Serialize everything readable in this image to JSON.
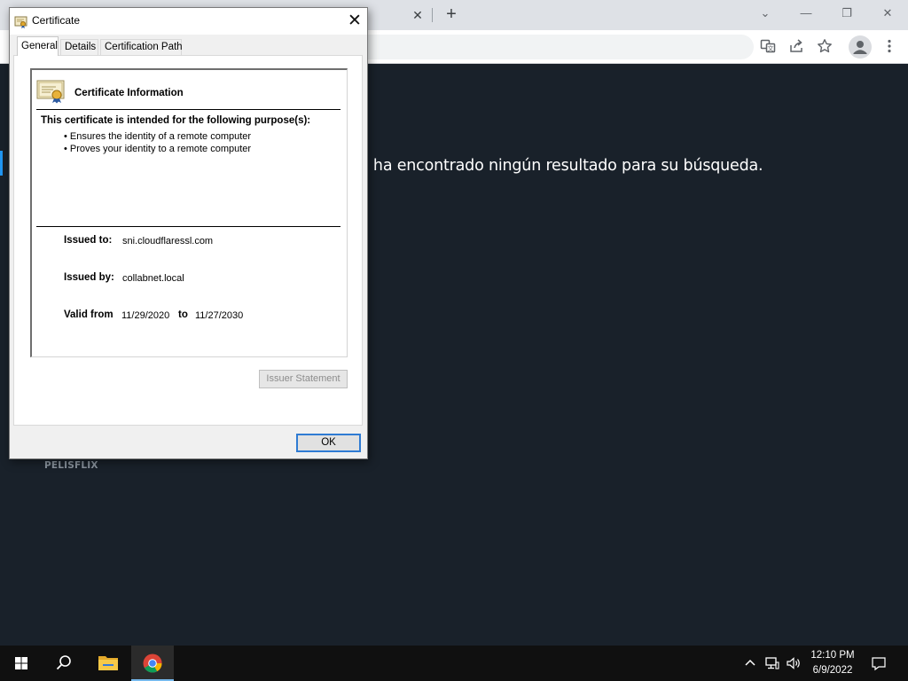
{
  "browser": {
    "tab_close_glyph": "✕",
    "new_tab_glyph": "+",
    "window_controls": {
      "tab_search": "⌄",
      "minimize": "—",
      "restore": "❐",
      "close": "✕"
    },
    "toolbar_icons": [
      "translate-icon",
      "share-icon",
      "star-icon",
      "profile-icon",
      "menu-icon"
    ]
  },
  "page": {
    "no_results_text": "e ha encontrado ningún resultado para su búsqueda.",
    "brand": "PELISFLIX",
    "background_color": "#19212a",
    "accent_color": "#2196f3"
  },
  "dialog": {
    "title": "Certificate",
    "close_glyph": "✕",
    "tabs": [
      {
        "label": "General",
        "active": true
      },
      {
        "label": "Details",
        "active": false
      },
      {
        "label": "Certification Path",
        "active": false
      }
    ],
    "info_heading": "Certificate Information",
    "purpose_heading": "This certificate is intended for the following purpose(s):",
    "purposes": [
      "Ensures the identity of a remote computer",
      "Proves your identity to a remote computer"
    ],
    "issued_to_label": "Issued to:",
    "issued_to": "sni.cloudflaressl.com",
    "issued_by_label": "Issued by:",
    "issued_by": "collabnet.local",
    "valid_from_label": "Valid from",
    "valid_from": "11/29/2020",
    "valid_to_label": "to",
    "valid_to": "11/27/2030",
    "issuer_statement_label": "Issuer Statement",
    "ok_label": "OK"
  },
  "taskbar": {
    "time": "12:10 PM",
    "date": "6/9/2022",
    "items": [
      "start-icon",
      "search-icon",
      "file-explorer-icon",
      "chrome-icon"
    ]
  }
}
